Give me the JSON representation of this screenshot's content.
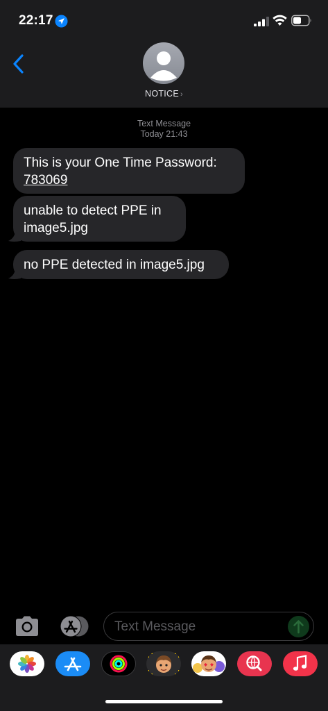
{
  "status_bar": {
    "time": "22:17",
    "icons": [
      "location-arrow-icon",
      "cellular-signal-icon",
      "wifi-icon",
      "battery-icon"
    ]
  },
  "header": {
    "back_icon": "chevron-left-icon",
    "contact_name": "NOTICE",
    "contact_chevron": "›"
  },
  "conversation": {
    "service_label": "Text Message",
    "timestamp": "Today 21:43",
    "messages": [
      {
        "line1": "This is your One Time Password:",
        "line2": "783069"
      },
      {
        "line1": "unable to detect PPE in",
        "line2": "image5.jpg"
      },
      {
        "line1": "no PPE detected in image5.jpg"
      }
    ]
  },
  "composer": {
    "placeholder": "Text Message",
    "camera_icon": "camera-icon",
    "apps_icon": "app-store-icon",
    "send_icon": "arrow-up-icon"
  },
  "app_drawer": {
    "apps": [
      "photos-icon",
      "app-store-icon",
      "fitness-rings-icon",
      "memoji-icon",
      "animoji-icon",
      "web-search-icon",
      "music-icon"
    ]
  },
  "colors": {
    "accent_blue": "#0a84ff",
    "bubble_gray": "#262629",
    "header_bg": "#1c1c1e"
  }
}
